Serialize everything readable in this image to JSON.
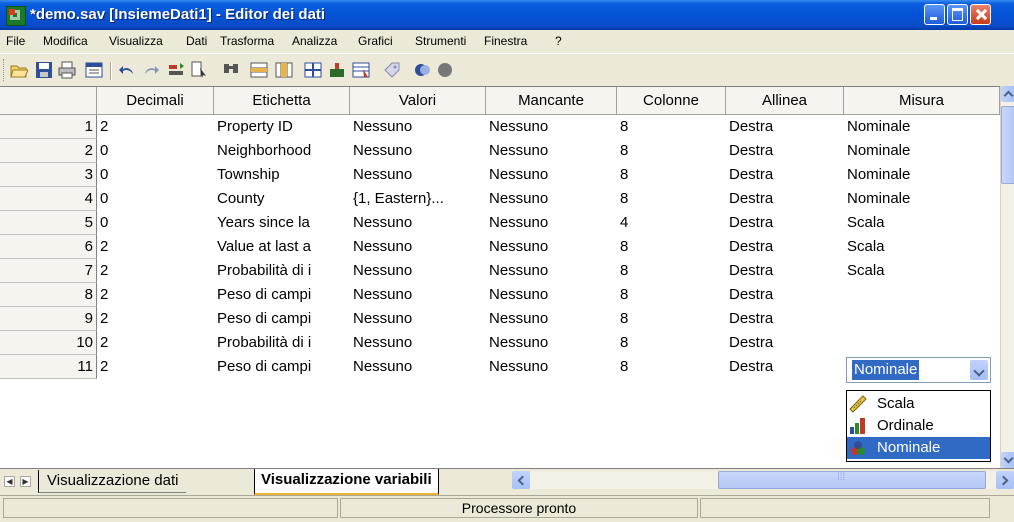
{
  "window": {
    "title": "*demo.sav [InsiemeDati1] - Editor dei dati"
  },
  "menu": [
    "File",
    "Modifica",
    "Visualizza",
    "Dati",
    "Trasforma",
    "Analizza",
    "Grafici",
    "Strumenti",
    "Finestra",
    "?"
  ],
  "columns": [
    "Decimali",
    "Etichetta",
    "Valori",
    "Mancante",
    "Colonne",
    "Allinea",
    "Misura"
  ],
  "rows": [
    {
      "n": "1",
      "decimali": "2",
      "etichetta": "Property ID",
      "valori": "Nessuno",
      "mancante": "Nessuno",
      "colonne": "8",
      "allinea": "Destra",
      "misura": "Nominale"
    },
    {
      "n": "2",
      "decimali": "0",
      "etichetta": "Neighborhood",
      "valori": "Nessuno",
      "mancante": "Nessuno",
      "colonne": "8",
      "allinea": "Destra",
      "misura": "Nominale"
    },
    {
      "n": "3",
      "decimali": "0",
      "etichetta": "Township",
      "valori": "Nessuno",
      "mancante": "Nessuno",
      "colonne": "8",
      "allinea": "Destra",
      "misura": "Nominale"
    },
    {
      "n": "4",
      "decimali": "0",
      "etichetta": "County",
      "valori": "{1, Eastern}...",
      "mancante": "Nessuno",
      "colonne": "8",
      "allinea": "Destra",
      "misura": "Nominale"
    },
    {
      "n": "5",
      "decimali": "0",
      "etichetta": "Years since la",
      "valori": "Nessuno",
      "mancante": "Nessuno",
      "colonne": "4",
      "allinea": "Destra",
      "misura": "Scala"
    },
    {
      "n": "6",
      "decimali": "2",
      "etichetta": "Value at last a",
      "valori": "Nessuno",
      "mancante": "Nessuno",
      "colonne": "8",
      "allinea": "Destra",
      "misura": "Scala"
    },
    {
      "n": "7",
      "decimali": "2",
      "etichetta": "Probabilità di i",
      "valori": "Nessuno",
      "mancante": "Nessuno",
      "colonne": "8",
      "allinea": "Destra",
      "misura": "Scala"
    },
    {
      "n": "8",
      "decimali": "2",
      "etichetta": "Peso di campi",
      "valori": "Nessuno",
      "mancante": "Nessuno",
      "colonne": "8",
      "allinea": "Destra",
      "misura": ""
    },
    {
      "n": "9",
      "decimali": "2",
      "etichetta": "Peso di campi",
      "valori": "Nessuno",
      "mancante": "Nessuno",
      "colonne": "8",
      "allinea": "Destra",
      "misura": ""
    },
    {
      "n": "10",
      "decimali": "2",
      "etichetta": "Probabilità di i",
      "valori": "Nessuno",
      "mancante": "Nessuno",
      "colonne": "8",
      "allinea": "Destra",
      "misura": ""
    },
    {
      "n": "11",
      "decimali": "2",
      "etichetta": "Peso di campi",
      "valori": "Nessuno",
      "mancante": "Nessuno",
      "colonne": "8",
      "allinea": "Destra",
      "misura": ""
    }
  ],
  "editor": {
    "selected_value": "Nominale",
    "options": [
      {
        "label": "Scala",
        "icon": "ruler-icon"
      },
      {
        "label": "Ordinale",
        "icon": "bar-chart-icon"
      },
      {
        "label": "Nominale",
        "icon": "nominal-icon"
      }
    ]
  },
  "tabs": {
    "data_view": "Visualizzazione dati",
    "variable_view": "Visualizzazione variabili"
  },
  "status": {
    "text": "Processore pronto"
  },
  "colors": {
    "titlebar": "#0453D6",
    "selection": "#316AC5",
    "tab_underline": "#F0B232"
  }
}
